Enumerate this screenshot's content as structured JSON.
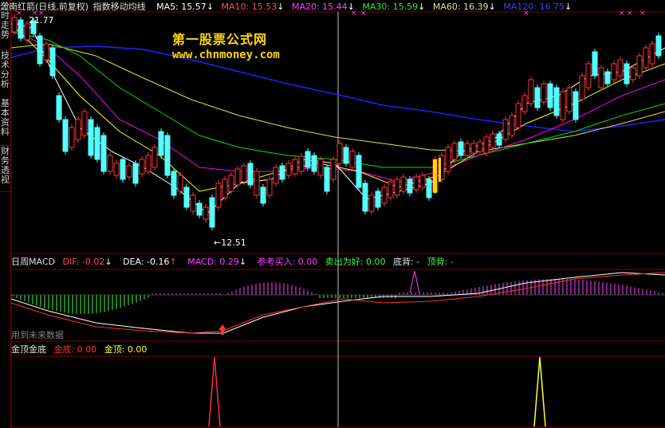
{
  "side_tabs": [
    {
      "label": "分时走势"
    },
    {
      "label": "技术分析"
    },
    {
      "label": "基本资料"
    },
    {
      "label": "财务透视"
    }
  ],
  "main_header": {
    "stock": "江南红箭(日线,前复权)",
    "indicator": "指数移动均线",
    "ma5": "MA5: 15.57",
    "ma10": "MA10: 15.53",
    "ma20": "MA20: 15.44",
    "ma30": "MA30: 15.59",
    "ma60": "MA60: 16.39",
    "ma120": "MA120: 16.75",
    "high_label": "21.77",
    "low_label": "←12.51"
  },
  "watermark": {
    "title": "第一股票公式网",
    "url": "www.chnmoney.com"
  },
  "macd_header": {
    "name": "日周MACD",
    "dif": "DIF: -0.02",
    "dea": "DEA: -0.16",
    "macd": "MACD: 0.29",
    "ref_buy": "参考买入: 0.00",
    "sell": "卖出为好: 0.00",
    "bottom_div": "底背: -",
    "top_div": "顶背: -",
    "note": "用到未来数据"
  },
  "gold_header": {
    "name": "金顶金底",
    "bottom": "金底: 0.00",
    "top": "金顶: 0.00"
  },
  "colors": {
    "up": "#ff3232",
    "down": "#54ffff",
    "ma5": "#ffffff",
    "ma10": "#ffff00",
    "ma20": "#ff00ff",
    "ma30": "#00e000",
    "ma60": "#e0e040",
    "ma120": "#2020ff",
    "grid": "#800000"
  }
}
